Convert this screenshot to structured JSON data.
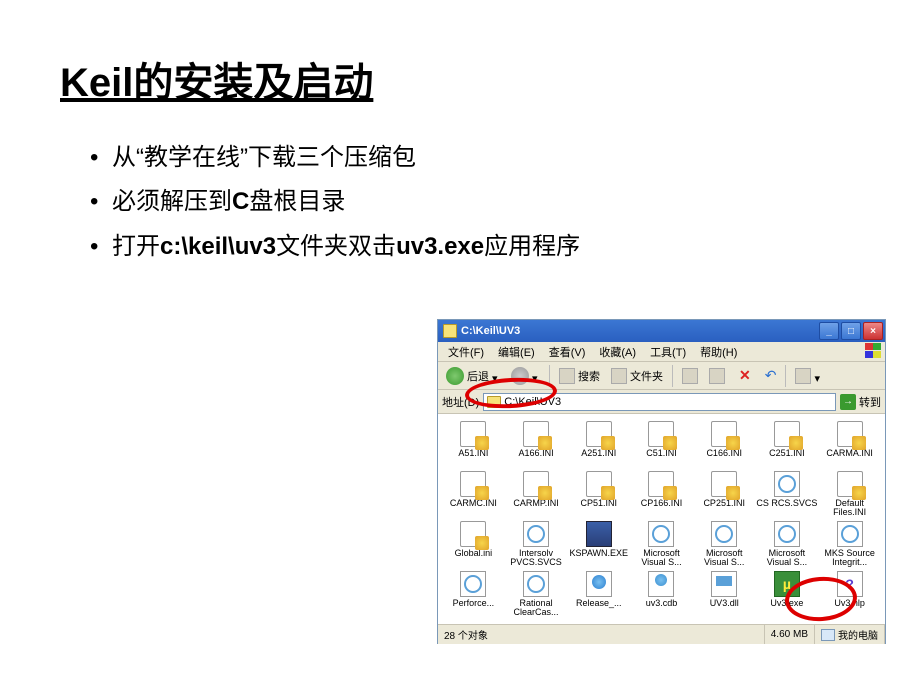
{
  "title": "Keil的安装及启动",
  "bullets": [
    {
      "pre": "从“教学在线”下载三个压缩包"
    },
    {
      "pre": "必须解压到",
      "bold": "C",
      "post": "盘根目录"
    },
    {
      "pre": "打开",
      "bold": "c:\\keil\\uv3",
      "mid": "文件夹双击",
      "bold2": "uv3.exe",
      "post": "应用程序"
    }
  ],
  "explorer": {
    "title": "C:\\Keil\\UV3",
    "menu": [
      "文件(F)",
      "编辑(E)",
      "查看(V)",
      "收藏(A)",
      "工具(T)",
      "帮助(H)"
    ],
    "toolbar": {
      "back": "后退",
      "search": "搜索",
      "folders": "文件夹"
    },
    "address_label": "地址(D)",
    "address_value": "C:\\Keil\\UV3",
    "go": "转到",
    "status_items": "28 个对象",
    "status_size": "4.60 MB",
    "status_loc": "我的电脑",
    "files": [
      {
        "n": "A51.INI",
        "t": "ini"
      },
      {
        "n": "A166.INI",
        "t": "ini"
      },
      {
        "n": "A251.INI",
        "t": "ini"
      },
      {
        "n": "C51.INI",
        "t": "ini"
      },
      {
        "n": "C166.INI",
        "t": "ini"
      },
      {
        "n": "C251.INI",
        "t": "ini"
      },
      {
        "n": "CARMA.INI",
        "t": "ini"
      },
      {
        "n": "CARMC.INI",
        "t": "ini"
      },
      {
        "n": "CARMP.INI",
        "t": "ini"
      },
      {
        "n": "CP51.INI",
        "t": "ini"
      },
      {
        "n": "CP166.INI",
        "t": "ini"
      },
      {
        "n": "CP251.INI",
        "t": "ini"
      },
      {
        "n": "CS RCS.SVCS",
        "t": "svcs"
      },
      {
        "n": "Default Files.INI",
        "t": "ini"
      },
      {
        "n": "Global.ini",
        "t": "ini"
      },
      {
        "n": "Intersolv PVCS.SVCS",
        "t": "svcs"
      },
      {
        "n": "KSPAWN.EXE",
        "t": "exe"
      },
      {
        "n": "Microsoft Visual S...",
        "t": "svcs"
      },
      {
        "n": "Microsoft Visual S...",
        "t": "svcs"
      },
      {
        "n": "Microsoft Visual S...",
        "t": "svcs"
      },
      {
        "n": "MKS Source Integrit...",
        "t": "svcs"
      },
      {
        "n": "Perforce...",
        "t": "svcs"
      },
      {
        "n": "Rational ClearCas...",
        "t": "svcs"
      },
      {
        "n": "Release_...",
        "t": "rel"
      },
      {
        "n": "uv3.cdb",
        "t": "cdb"
      },
      {
        "n": "UV3.dll",
        "t": "dll"
      },
      {
        "n": "Uv3.exe",
        "t": "uv3"
      },
      {
        "n": "Uv3.hlp",
        "t": "hlp"
      }
    ]
  }
}
